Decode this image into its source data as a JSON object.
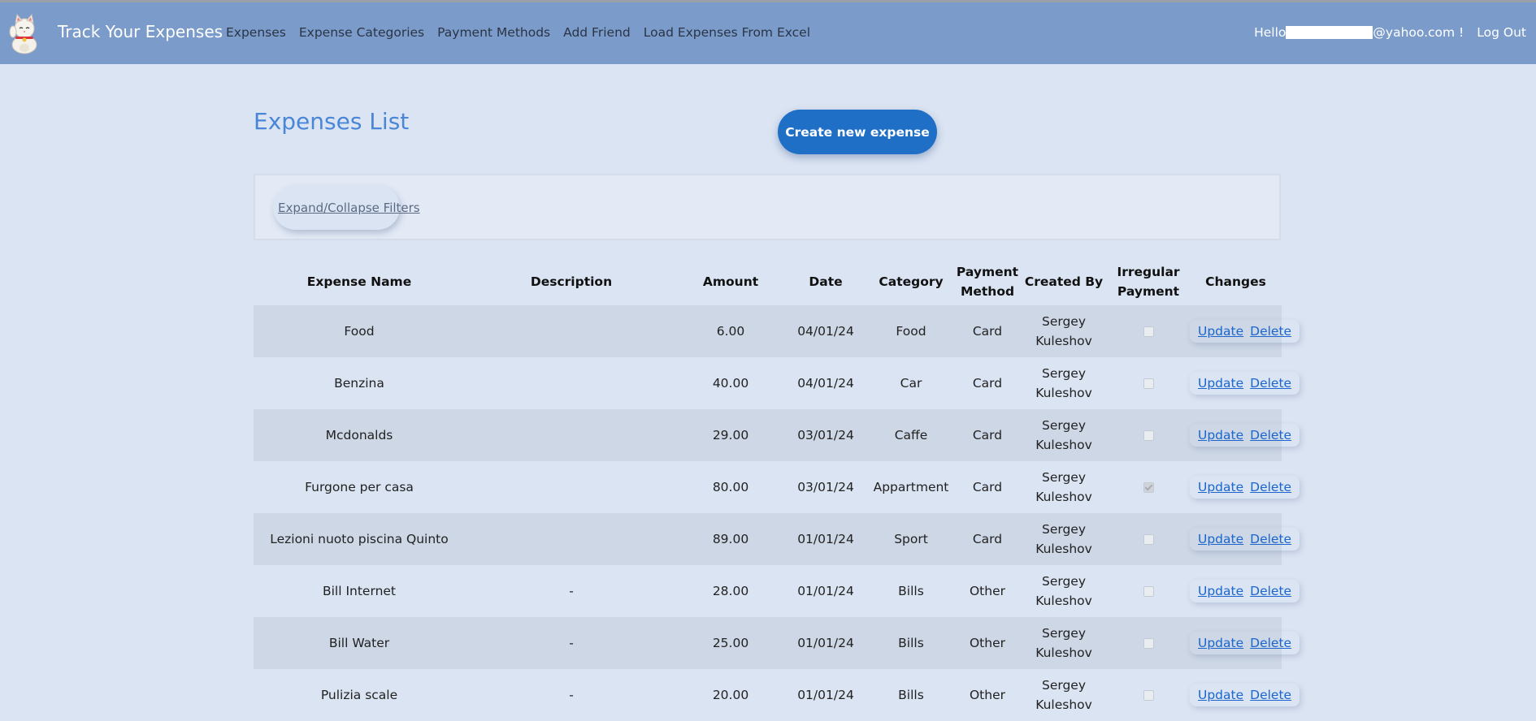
{
  "navbar": {
    "brand": "Track Your Expenses",
    "links": [
      "Expenses",
      "Expense Categories",
      "Payment Methods",
      "Add Friend",
      "Load Expenses From Excel"
    ],
    "hello_prefix": "Hello",
    "email_suffix": "@yahoo.com !",
    "logout": "Log Out",
    "bg_color": "#7b9ccb"
  },
  "main": {
    "title": "Expenses List",
    "create_button": "Create new expense",
    "filters_toggle": "Expand/Collapse Filters"
  },
  "table": {
    "headers": [
      "Expense Name",
      "Description",
      "Amount",
      "Date",
      "Category",
      "Payment Method",
      "Created By",
      "Irregular Payment",
      "Changes"
    ],
    "update_label": "Update",
    "delete_label": "Delete",
    "rows": [
      {
        "name": "Food",
        "description": "",
        "amount": "6.00",
        "date": "04/01/24",
        "category": "Food",
        "payment": "Card",
        "created_by": "Sergey Kuleshov",
        "irregular": false
      },
      {
        "name": "Benzina",
        "description": "",
        "amount": "40.00",
        "date": "04/01/24",
        "category": "Car",
        "payment": "Card",
        "created_by": "Sergey Kuleshov",
        "irregular": false
      },
      {
        "name": "Mcdonalds",
        "description": "",
        "amount": "29.00",
        "date": "03/01/24",
        "category": "Caffe",
        "payment": "Card",
        "created_by": "Sergey Kuleshov",
        "irregular": false
      },
      {
        "name": "Furgone per casa",
        "description": "",
        "amount": "80.00",
        "date": "03/01/24",
        "category": "Appartment",
        "payment": "Card",
        "created_by": "Sergey Kuleshov",
        "irregular": true
      },
      {
        "name": "Lezioni nuoto piscina Quinto",
        "description": "",
        "amount": "89.00",
        "date": "01/01/24",
        "category": "Sport",
        "payment": "Card",
        "created_by": "Sergey Kuleshov",
        "irregular": false
      },
      {
        "name": "Bill Internet",
        "description": "-",
        "amount": "28.00",
        "date": "01/01/24",
        "category": "Bills",
        "payment": "Other",
        "created_by": "Sergey Kuleshov",
        "irregular": false
      },
      {
        "name": "Bill Water",
        "description": "-",
        "amount": "25.00",
        "date": "01/01/24",
        "category": "Bills",
        "payment": "Other",
        "created_by": "Sergey Kuleshov",
        "irregular": false
      },
      {
        "name": "Pulizia scale",
        "description": "-",
        "amount": "20.00",
        "date": "01/01/24",
        "category": "Bills",
        "payment": "Other",
        "created_by": "Sergey Kuleshov",
        "irregular": false
      }
    ]
  }
}
